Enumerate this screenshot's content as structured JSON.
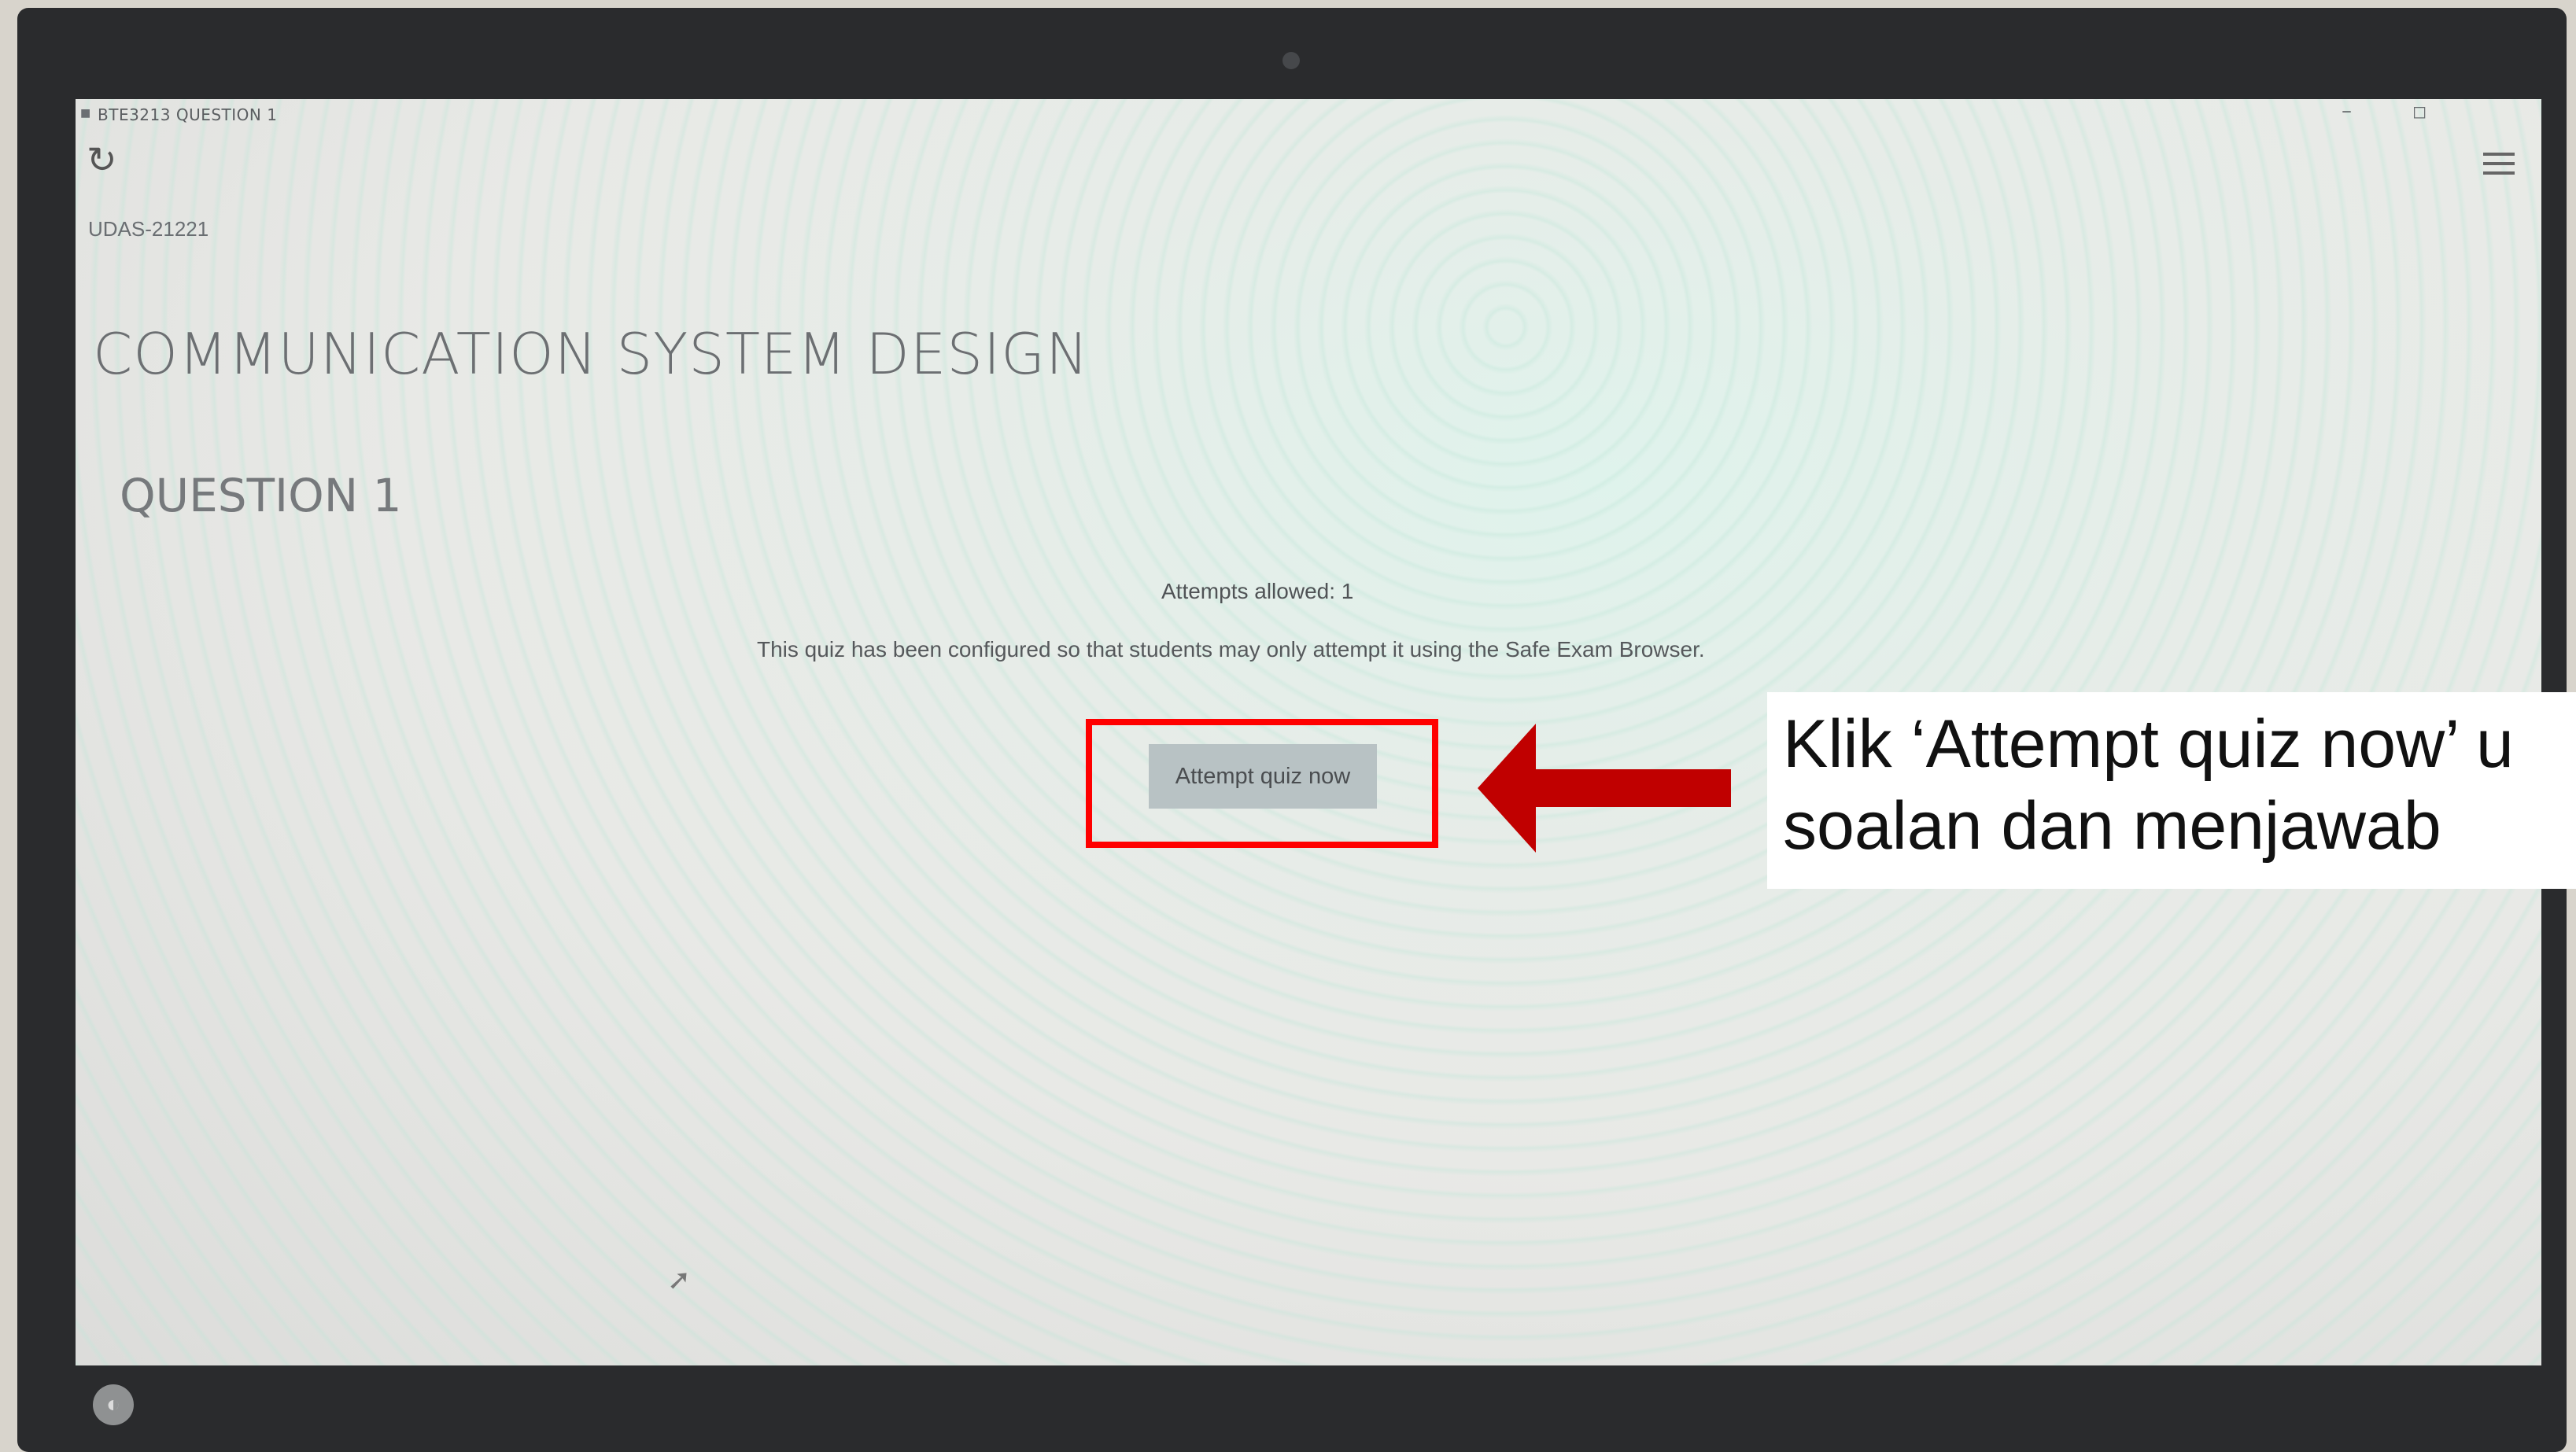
{
  "window": {
    "title": "BTE3213 QUESTION 1",
    "minimize_glyph": "–",
    "maximize_glyph": "◻"
  },
  "toolbar": {
    "reload_icon": "reload-icon",
    "menu_icon": "hamburger-menu-icon"
  },
  "page": {
    "course_id": "UDAS-21221",
    "course_title": "COMMUNICATION SYSTEM DESIGN",
    "quiz_title": "QUESTION 1",
    "attempts_allowed": "Attempts allowed: 1",
    "config_message": "This quiz has been configured so that students may only attempt it using the Safe Exam Browser.",
    "attempt_button": "Attempt quiz now"
  },
  "annotation": {
    "callout_line1": "Klik ‘Attempt quiz now’ u",
    "callout_line2": "soalan dan menjawab",
    "highlight_color": "#ff0000",
    "arrow_color": "#c00000"
  }
}
